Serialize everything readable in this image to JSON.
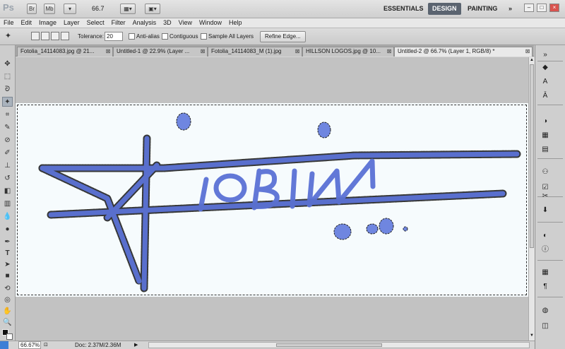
{
  "app": {
    "logo": "Ps",
    "btn_br": "Br",
    "btn_mb": "Mb",
    "zoom": "66.7",
    "workspaces": [
      "ESSENTIALS",
      "DESIGN",
      "PAINTING"
    ],
    "active_workspace": "DESIGN"
  },
  "menu": [
    "File",
    "Edit",
    "Image",
    "Layer",
    "Select",
    "Filter",
    "Analysis",
    "3D",
    "View",
    "Window",
    "Help"
  ],
  "options": {
    "tolerance_label": "Tolerance:",
    "tolerance_value": "20",
    "anti_alias": "Anti-alias",
    "contiguous": "Contiguous",
    "sample_all_layers": "Sample All Layers",
    "refine_edge": "Refine Edge..."
  },
  "tabs": [
    {
      "label": "Fotolia_14114083.jpg @ 21..."
    },
    {
      "label": "Untitled-1 @ 22.9% (Layer ..."
    },
    {
      "label": "Fotolia_14114083_M (1).jpg"
    },
    {
      "label": "HILLSON LOGOS.jpg @ 10..."
    },
    {
      "label": "Untitled-2 @ 66.7% (Layer 1, RGB/8) *"
    }
  ],
  "status": {
    "zoom": "66.67%",
    "doc": "Doc: 2.37M/2.36M"
  },
  "colors": {
    "ink": "#5b72d6",
    "canvas": "#f6fbfd",
    "workspace_bg": "#c2c2c2",
    "active_ws": "#5b6470"
  }
}
